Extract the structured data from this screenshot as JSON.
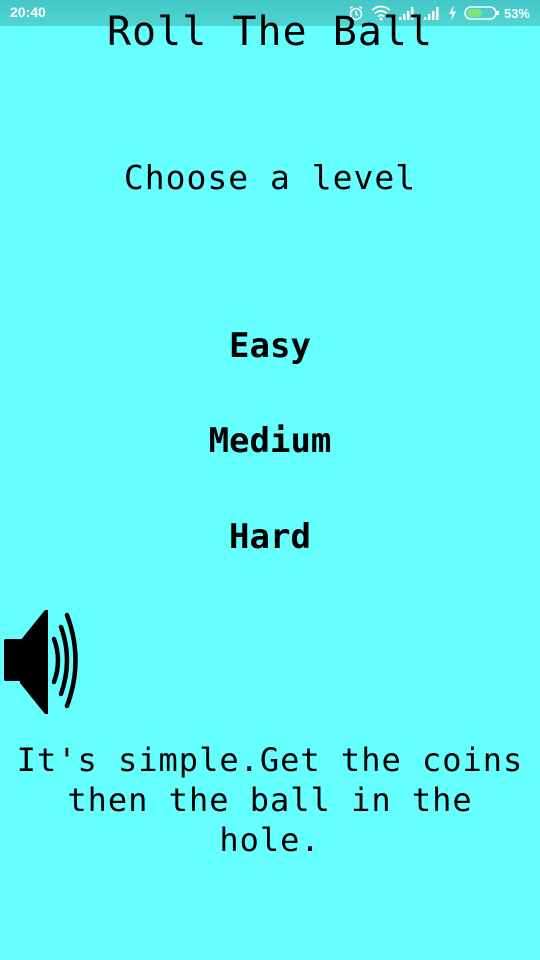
{
  "status_bar": {
    "time": "20:40",
    "battery_percent": "53%",
    "icons": [
      "alarm-icon",
      "wifi-icon",
      "signal-icon",
      "signal-icon",
      "charging-icon",
      "battery-icon"
    ]
  },
  "game": {
    "title": "Roll The Ball",
    "subtitle": "Choose a level",
    "levels": {
      "easy": "Easy",
      "medium": "Medium",
      "hard": "Hard"
    },
    "sound_icon": "speaker-icon",
    "instructions": "It's simple.Get the coins\nthen  the ball in the\nhole."
  },
  "colors": {
    "background": "#66ffff",
    "text": "#000000",
    "status_bar": "#4fd4d4",
    "battery_fill": "#7be37b"
  }
}
